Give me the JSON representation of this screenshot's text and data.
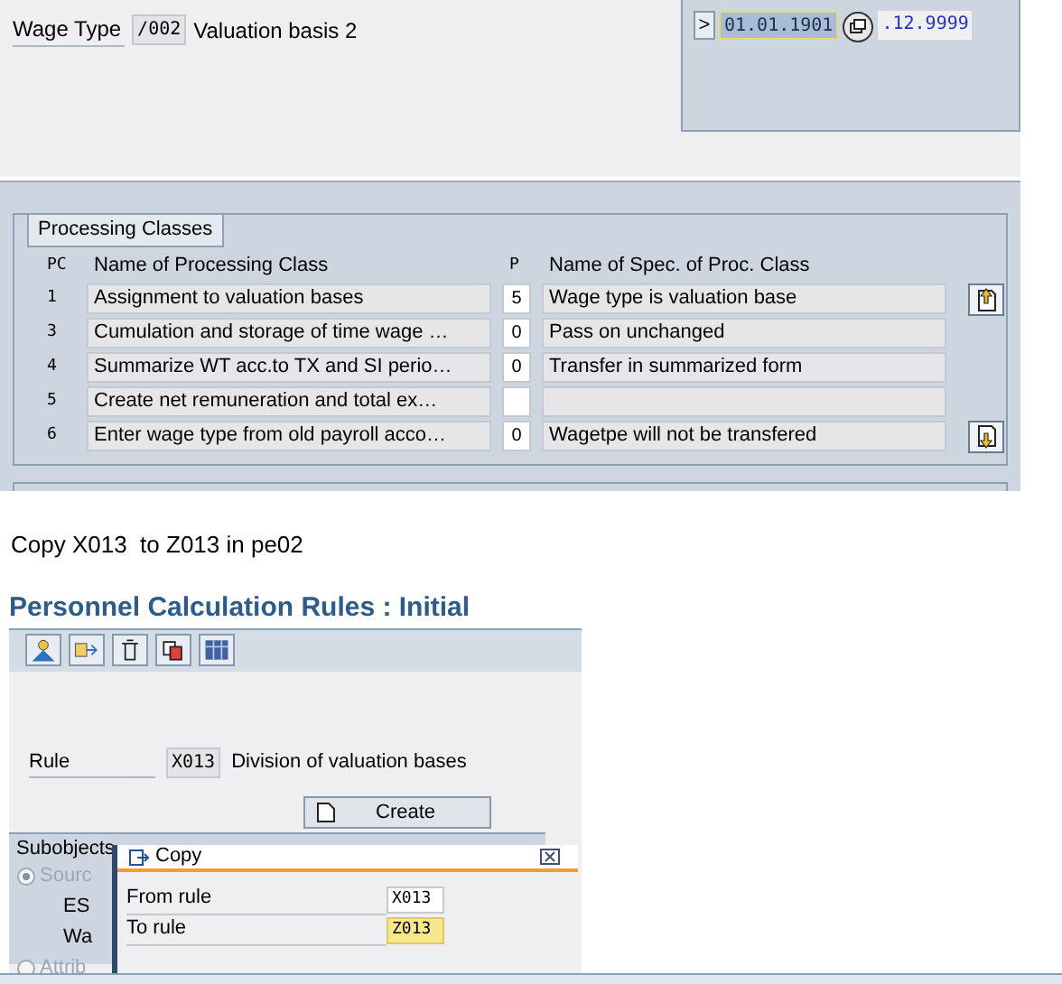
{
  "wage_type": {
    "label": "Wage Type",
    "code": "/002",
    "text": "Valuation basis 2"
  },
  "validity": {
    "button": ">",
    "start": "01.01.1901",
    "end": ".12.9999"
  },
  "processing_classes": {
    "title": "Processing Classes",
    "columns": [
      "PC",
      "Name of Processing Class",
      "P",
      "Name of Spec. of Proc. Class"
    ],
    "rows": [
      {
        "pc": "1",
        "name": "Assignment to valuation bases",
        "p": "5",
        "spec": "Wage type is valuation base"
      },
      {
        "pc": "3",
        "name": "Cumulation and storage of time wage …",
        "p": "0",
        "spec": "Pass on unchanged"
      },
      {
        "pc": "4",
        "name": "Summarize WT acc.to TX and SI perio…",
        "p": "0",
        "spec": "Transfer in summarized form"
      },
      {
        "pc": "5",
        "name": "Create net remuneration and total ex…"
      },
      {
        "pc": "6",
        "name": "Enter wage type from old payroll acco…",
        "p": "0",
        "spec": "Wagetpe will not be transfered"
      }
    ]
  },
  "note": "Copy X013  to Z013 in pe02",
  "screen": {
    "title": "Personnel Calculation Rules : Initial",
    "rule": {
      "label": "Rule",
      "code": "X013",
      "text": "Division of valuation bases"
    },
    "create_button": "Create",
    "subobjects": {
      "title": "Subobjects",
      "items": [
        {
          "label": "Sourc",
          "kind": "radio",
          "selected": true
        },
        {
          "label": "ES",
          "kind": "text"
        },
        {
          "label": "Wa",
          "kind": "text"
        },
        {
          "label": "Attrib",
          "kind": "radio",
          "selected": false
        }
      ]
    }
  },
  "dialog": {
    "title": "Copy",
    "fields": [
      {
        "label": "From rule",
        "value": "X013",
        "focused": false
      },
      {
        "label": "To rule",
        "value": "Z013",
        "focused": true
      }
    ]
  }
}
